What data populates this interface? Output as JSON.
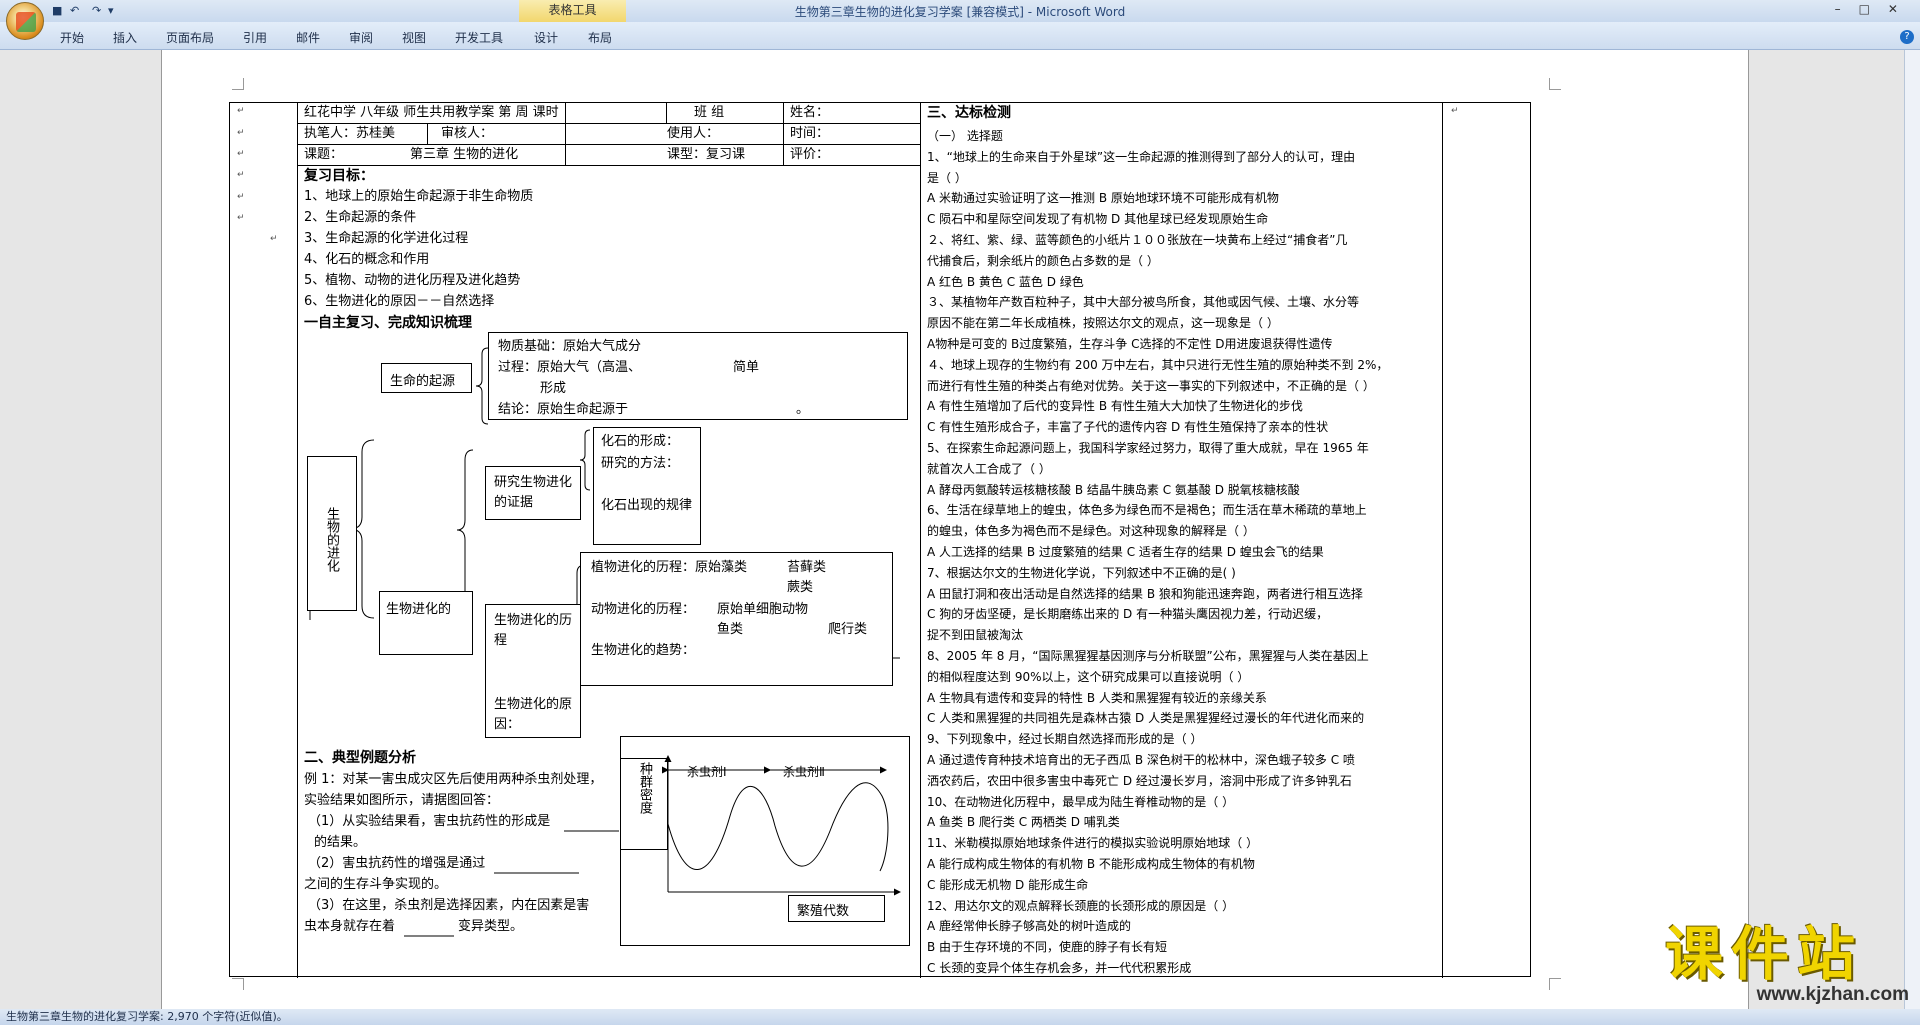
{
  "titlebar": {
    "title": "生物第三章生物的进化复习学案 [兼容模式] - ",
    "app": "Microsoft Word",
    "context_tab": "表格工具",
    "undo": "↶",
    "redo": "↷",
    "save": "■",
    "qat_more": "▾",
    "controls": "–□✕"
  },
  "ribbon": {
    "tabs": [
      "开始",
      "插入",
      "页面布局",
      "引用",
      "邮件",
      "审阅",
      "视图",
      "开发工具",
      "设计",
      "布局"
    ],
    "help": "?"
  },
  "status": {
    "text": "生物第三章生物的进化复习学案: 2,970 个字符(近似值)。"
  },
  "watermark": {
    "main": "课件站",
    "url": "www.kjzhan.com"
  },
  "marks": {
    "para": "↵"
  },
  "header": {
    "school": "红花中学   八年级   师生共用教学案     第     周     课时",
    "class": "班     组",
    "name": "姓名：",
    "writer": "执笔人：苏桂美",
    "reviewer": "审核人：",
    "user": "使用人：",
    "time": "时间：",
    "topic_label": "课题：",
    "topic": "第三章   生物的进化",
    "type": "课型：复习课",
    "evaluation": "评价："
  },
  "objectives": {
    "title": "复习目标：",
    "items": [
      "1、地球上的原始生命起源于非生命物质",
      "2、生命起源的条件",
      "3、生命起源的化学进化过程",
      "4、化石的概念和作用",
      "5、植物、动物的进化历程及进化趋势",
      "6、生物进化的原因－－自然选择"
    ]
  },
  "section1": "一自主复习、完成知识梳理",
  "diagram": {
    "root": "生物的进化",
    "origin": "生命的起源",
    "material": "物质基础：原始大气成分",
    "process": "过程：原始大气（高温、",
    "simple": "简单",
    "formed": "形成",
    "conclusion": "结论：原始生命起源于",
    "conclusion_end": "。",
    "evolution": "生物进化的",
    "study": "研究生物进化的证据",
    "fossil_form": "化石的形成：",
    "study_method": "研究的方法：",
    "fossil_law": "化石出现的规律",
    "course_title": "生物进化的历程",
    "cause_title": "生物进化的原因：",
    "plant_course": "植物进化的历程：原始藻类",
    "moss": "苔藓类",
    "fern": "蕨类",
    "animal_course": "动物进化的历程：",
    "single_cell": "原始单细胞动物",
    "fish": "鱼类",
    "reptile": "爬行类",
    "trend": "生物进化的趋势："
  },
  "section2": {
    "title": "二、典型例题分析",
    "lines": [
      "例 1：对某一害虫成灾区先后使用两种杀虫剂处理，",
      "实验结果如图所示，请据图回答：",
      "（1）从实验结果看，害虫抗药性的形成是",
      "的结果。",
      "（2）害虫抗药性的增强是通过",
      "之间的生存斗争实现的。",
      "（3）在这里，杀虫剂是选择因素，内在因素是害",
      "虫本身就存在着",
      "变异类型。"
    ]
  },
  "figure": {
    "ylabel": "种群密度",
    "agent1": "杀虫剂Ⅰ",
    "agent2": "杀虫剂Ⅱ",
    "xlabel": "繁殖代数"
  },
  "right": {
    "title": "三、达标检测",
    "lines": [
      "（一） 选择题",
      "1、“地球上的生命来自于外星球”这一生命起源的推测得到了部分人的认可，理由",
      "是（  ）",
      "A  米勒通过实验证明了这一推测       B  原始地球环境不可能形成有机物",
      "C  陨石中和星际空间发现了有机物     D  其他星球已经发现原始生命",
      "２、将红、紫、绿、蓝等颜色的小纸片１００张放在一块黄布上经过“捕食者”几",
      "代捕食后，剩余纸片的颜色占多数的是（      ）",
      "A  红色      B  黄色       C  蓝色       D  绿色",
      "３、某植物年产数百粒种子，其中大部分被鸟所食，其他或因气候、土壤、水分等",
      "原因不能在第二年长成植株，按照达尔文的观点，这一现象是（     ）",
      "A物种是可变的 B过度繁殖，生存斗争 C选择的不定性 D用进废退获得性遗传",
      "４、地球上现存的生物约有 200 万中左右，其中只进行无性生殖的原始种类不到 2%，",
      "而进行有性生殖的种类占有绝对优势。关于这一事实的下列叙述中，不正确的是（ ）",
      "A 有性生殖增加了后代的变异性    B 有性生殖大大加快了生物进化的步伐",
      "C 有性生殖形成合子，丰富了子代的遗传内容   D 有性生殖保持了亲本的性状",
      "5、在探索生命起源问题上，我国科学家经过努力，取得了重大成就，早在 1965 年",
      "就首次人工合成了（     ）",
      "A 酵母丙氨酸转运核糖核酸    B 结晶牛胰岛素     C 氨基酸     D 脱氧核糖核酸",
      "6、生活在绿草地上的蝗虫，体色多为绿色而不是褐色；而生活在草木稀疏的草地上",
      "的蝗虫，体色多为褐色而不是绿色。对这种现象的解释是（       ）",
      "A 人工选择的结果   B 过度繁殖的结果   C 适者生存的结果   D 蝗虫会飞的结果",
      "7、根据达尔文的生物进化学说，下列叙述中不正确的是(     )",
      "A 田鼠打洞和夜出活动是自然选择的结果   B 狼和狗能迅速奔跑，两者进行相互选择",
      "C 狗的牙齿坚硬，是长期磨练出来的         D 有一种猫头鹰因视力差，行动迟缓，",
      "捉不到田鼠被淘汰",
      "8、2005 年 8 月，“国际黑猩猩基因测序与分析联盟”公布，黑猩猩与人类在基因上",
      "的相似程度达到 90%以上，这个研究成果可以直接说明（    ）",
      "A 生物具有遗传和变异的特性         B 人类和黑猩猩有较近的亲缘关系",
      "C 人类和黑猩猩的共同祖先是森林古猿 D 人类是黑猩猩经过漫长的年代进化而来的",
      "9、下列现象中，经过长期自然选择而形成的是（      ）",
      "A 通过遗传育种技术培育出的无子西瓜    B 深色树干的松林中，深色蛾子较多  C 喷",
      "洒农药后，农田中很多害虫中毒死亡   D 经过漫长岁月，溶洞中形成了许多钟乳石",
      "10、在动物进化历程中，最早成为陆生脊椎动物的是（    ）",
      "A 鱼类        B 爬行类       C 两栖类       D 哺乳类",
      "11、米勒模拟原始地球条件进行的模拟实验说明原始地球（     ）",
      "A 能行成构成生物体的有机物      B 不能形成构成生物体的有机物",
      "C 能形成无机物                  D 能形成生命",
      "12、用达尔文的观点解释长颈鹿的长颈形成的原因是（      ）",
      "A 鹿经常伸长脖子够高处的树叶造成的",
      "B 由于生存环境的不同，使鹿的脖子有长有短",
      "C 长颈的变异个体生存机会多，并一代代积累形成"
    ]
  }
}
